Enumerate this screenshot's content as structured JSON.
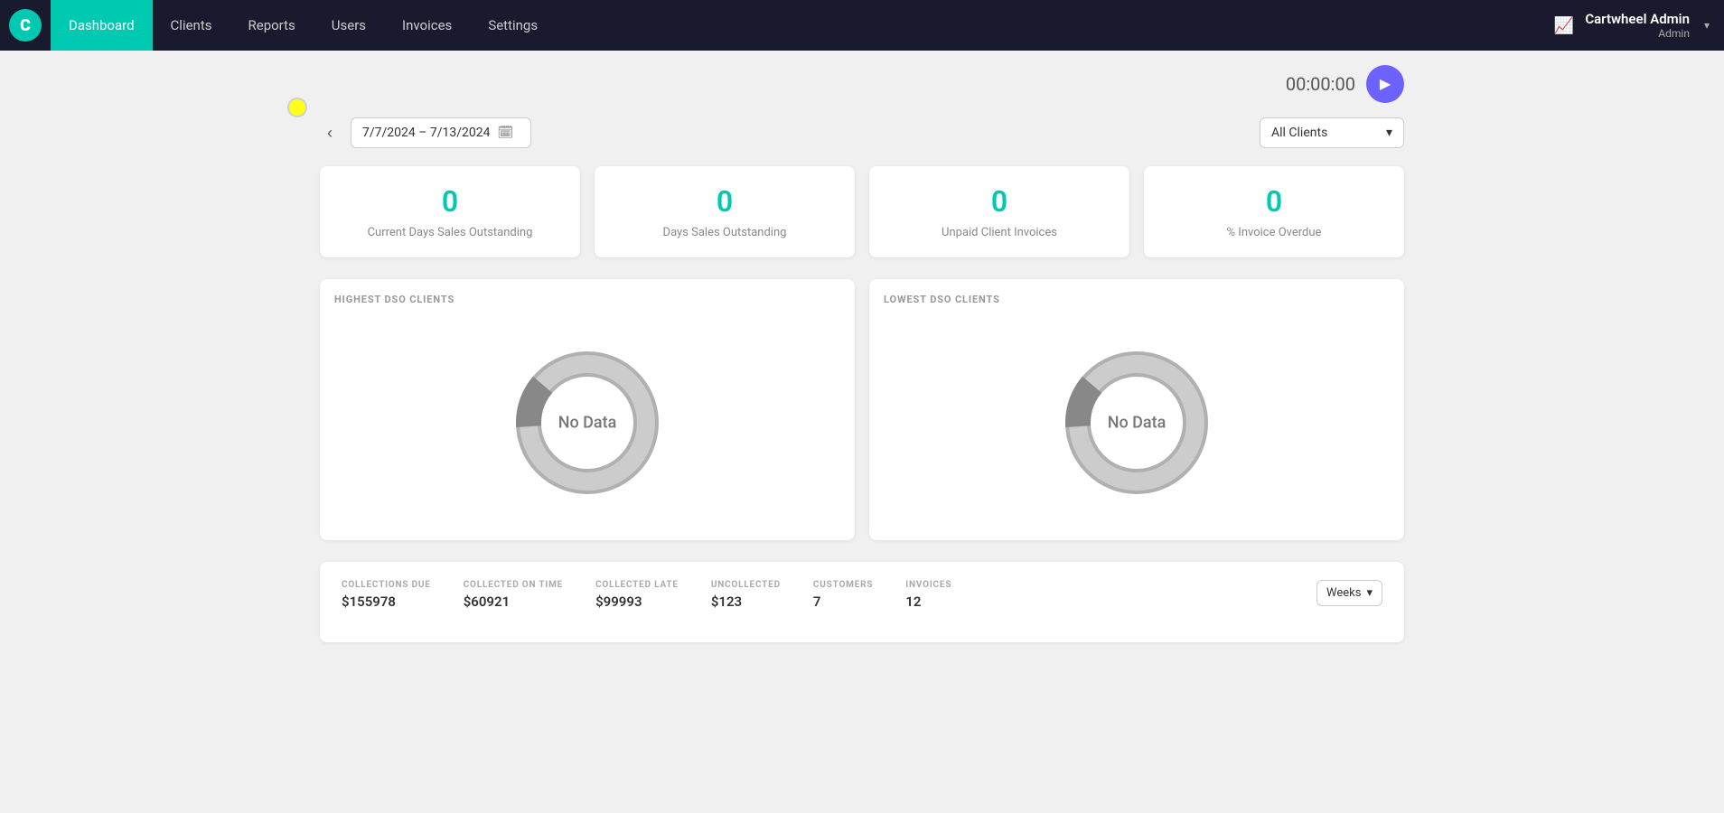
{
  "nav": {
    "logo_letter": "C",
    "items": [
      {
        "label": "Dashboard",
        "active": true
      },
      {
        "label": "Clients",
        "active": false
      },
      {
        "label": "Reports",
        "active": false
      },
      {
        "label": "Users",
        "active": false
      },
      {
        "label": "Invoices",
        "active": false
      },
      {
        "label": "Settings",
        "active": false
      }
    ],
    "user_name": "Cartwheel Admin",
    "user_role": "Admin",
    "dropdown_arrow": "▾"
  },
  "timer": {
    "display": "00:00:00",
    "play_icon": "▶"
  },
  "filters": {
    "date_range": "7/7/2024 – 7/13/2024",
    "date_icon": "📅",
    "prev_arrow": "‹",
    "clients_label": "All Clients",
    "clients_arrow": "▾"
  },
  "stats": [
    {
      "value": "0",
      "label": "Current Days Sales Outstanding"
    },
    {
      "value": "0",
      "label": "Days Sales Outstanding"
    },
    {
      "value": "0",
      "label": "Unpaid Client Invoices"
    },
    {
      "value": "0",
      "label": "% Invoice Overdue"
    }
  ],
  "dso_sections": [
    {
      "title": "HIGHEST DSO CLIENTS",
      "no_data": "No Data"
    },
    {
      "title": "LOWEST DSO CLIENTS",
      "no_data": "No Data"
    }
  ],
  "bottom": {
    "stats": [
      {
        "label": "COLLECTIONS DUE",
        "value": "$155978"
      },
      {
        "label": "COLLECTED ON TIME",
        "value": "$60921"
      },
      {
        "label": "COLLECTED LATE",
        "value": "$99993"
      },
      {
        "label": "UNCOLLECTED",
        "value": "$123"
      },
      {
        "label": "CUSTOMERS",
        "value": "7"
      },
      {
        "label": "INVOICES",
        "value": "12"
      }
    ],
    "dropdown_label": "Weeks",
    "dropdown_arrow": "▾"
  }
}
